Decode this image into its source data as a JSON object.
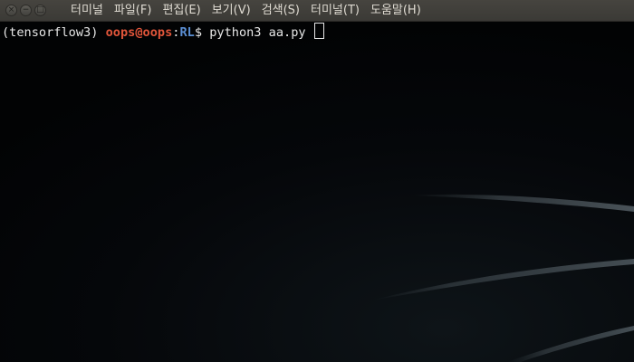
{
  "window_controls": {
    "close_glyph": "×",
    "minimize_glyph": "−",
    "maximize_glyph": "□"
  },
  "menubar": {
    "items": [
      {
        "label": "터미널"
      },
      {
        "label": "파일(F)"
      },
      {
        "label": "편집(E)"
      },
      {
        "label": "보기(V)"
      },
      {
        "label": "검색(S)"
      },
      {
        "label": "터미널(T)"
      },
      {
        "label": "도움말(H)"
      }
    ]
  },
  "terminal": {
    "prompt": {
      "env": "(tensorflow3)",
      "userhost": "oops@oops",
      "colon": ":",
      "path": "RL",
      "dollar": "$",
      "command": "python3 aa.py"
    }
  },
  "colors": {
    "background": "#030405",
    "menubar": "#3f3e3a",
    "userhost": "#e0553a",
    "path": "#5b8fd4",
    "text": "#e8e8e8"
  }
}
